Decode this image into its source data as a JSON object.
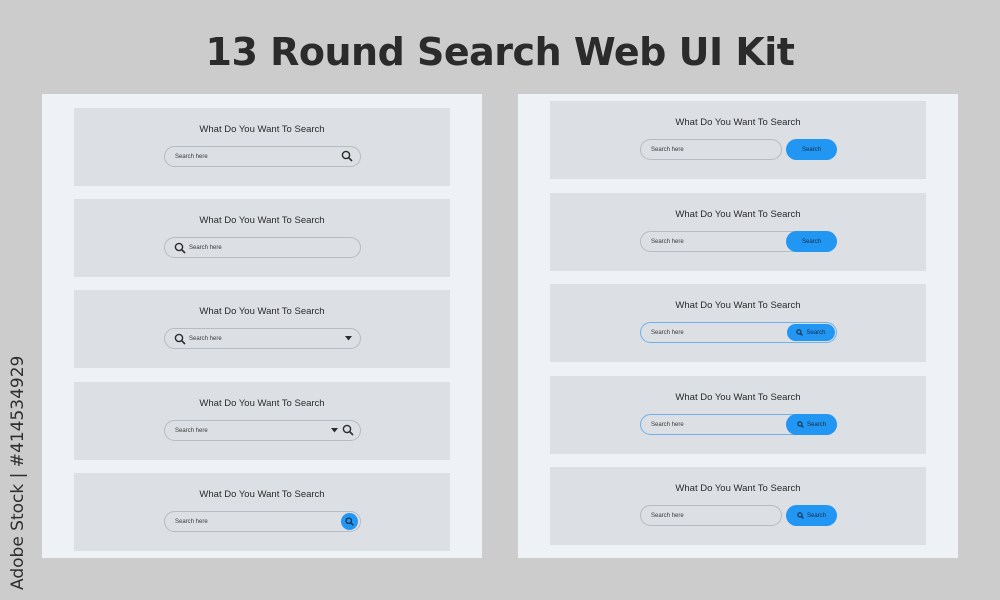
{
  "title": "13 Round Search Web UI Kit",
  "stock_id": "Adobe Stock | #414534929",
  "card_title": "What Do You Want To Search",
  "placeholder": "Search here",
  "button_label": "Search",
  "colors": {
    "background": "#cccccc",
    "panel": "#eef1f6",
    "card": "#dcdfe4",
    "accent": "#2196f3",
    "title_text": "#2b2b2b"
  },
  "left_cards": [
    {
      "variant": "right-search-icon"
    },
    {
      "variant": "left-search-icon"
    },
    {
      "variant": "left-search-icon-with-dropdown"
    },
    {
      "variant": "dropdown-and-right-search-icon"
    },
    {
      "variant": "round-blue-search-button"
    }
  ],
  "right_cards": [
    {
      "variant": "separate-blue-button"
    },
    {
      "variant": "attached-blue-button"
    },
    {
      "variant": "blue-outline-button-with-icon"
    },
    {
      "variant": "blue-outline-attached-button-with-icon"
    },
    {
      "variant": "separate-blue-button-with-icon"
    }
  ]
}
